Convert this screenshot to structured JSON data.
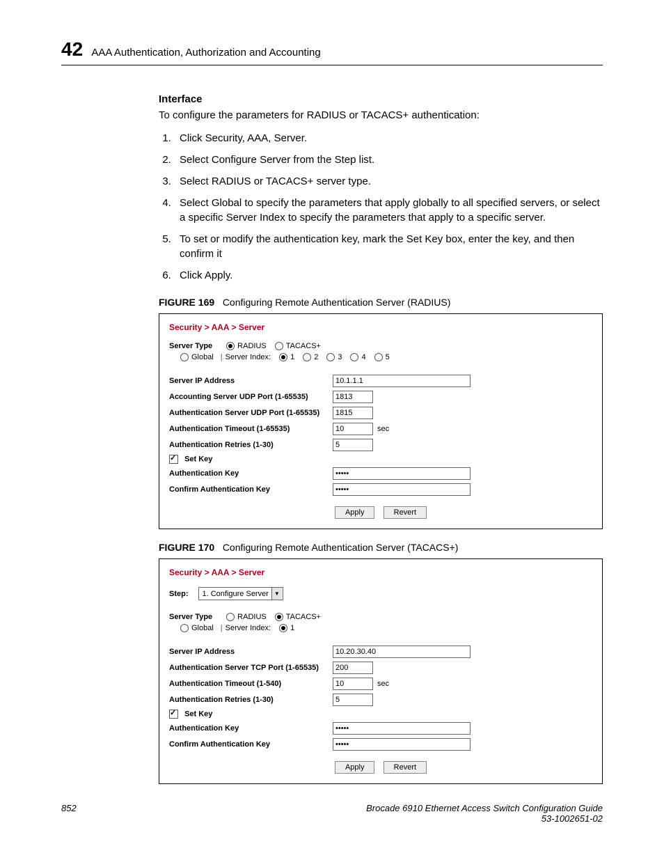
{
  "header": {
    "chapter_number": "42",
    "chapter_title": "AAA Authentication, Authorization and Accounting"
  },
  "section": {
    "heading": "Interface",
    "intro": "To configure the parameters for RADIUS or TACACS+ authentication:",
    "steps": [
      "Click Security, AAA, Server.",
      "Select Configure Server from the Step list.",
      "Select RADIUS or TACACS+ server type.",
      "Select Global to specify the parameters that apply globally to all specified servers, or select a specific Server Index to specify the parameters that apply to a specific server.",
      "To set or modify the authentication key, mark the Set Key box, enter the key, and then confirm it",
      "Click Apply."
    ]
  },
  "figures": {
    "f169": {
      "label": "FIGURE 169",
      "caption": "Configuring Remote Authentication Server (RADIUS)"
    },
    "f170": {
      "label": "FIGURE 170",
      "caption": "Configuring Remote Authentication Server (TACACS+)"
    }
  },
  "ui_common": {
    "breadcrumb": "Security > AAA > Server",
    "server_type_label": "Server Type",
    "radius_label": "RADIUS",
    "tacacs_label": "TACACS+",
    "global_label": "Global",
    "server_index_label": "Server Index:",
    "server_ip_label": "Server IP Address",
    "timeout_unit": "sec",
    "set_key_label": "Set Key",
    "auth_key_label": "Authentication Key",
    "confirm_key_label": "Confirm Authentication Key",
    "apply": "Apply",
    "revert": "Revert",
    "step_label": "Step:",
    "step_value": "1. Configure Server",
    "retries_label": "Authentication Retries (1-30)"
  },
  "panel169": {
    "acct_port_label": "Accounting Server UDP Port (1-65535)",
    "auth_port_label": "Authentication Server UDP Port (1-65535)",
    "timeout_label": "Authentication Timeout (1-65535)",
    "server_indices": [
      "1",
      "2",
      "3",
      "4",
      "5"
    ],
    "fields": {
      "server_ip": "10.1.1.1",
      "acct_port": "1813",
      "auth_port": "1815",
      "timeout": "10",
      "retries": "5",
      "auth_key_masked": "•••••",
      "confirm_key_masked": "•••••"
    }
  },
  "panel170": {
    "auth_port_label": "Authentication Server TCP Port (1-65535)",
    "timeout_label": "Authentication Timeout (1-540)",
    "server_indices": [
      "1"
    ],
    "fields": {
      "server_ip": "10.20.30.40",
      "auth_port": "200",
      "timeout": "10",
      "retries": "5",
      "auth_key_masked": "•••••",
      "confirm_key_masked": "•••••"
    }
  },
  "footer": {
    "page_number": "852",
    "book_title": "Brocade 6910 Ethernet Access Switch Configuration Guide",
    "doc_id": "53-1002651-02"
  }
}
